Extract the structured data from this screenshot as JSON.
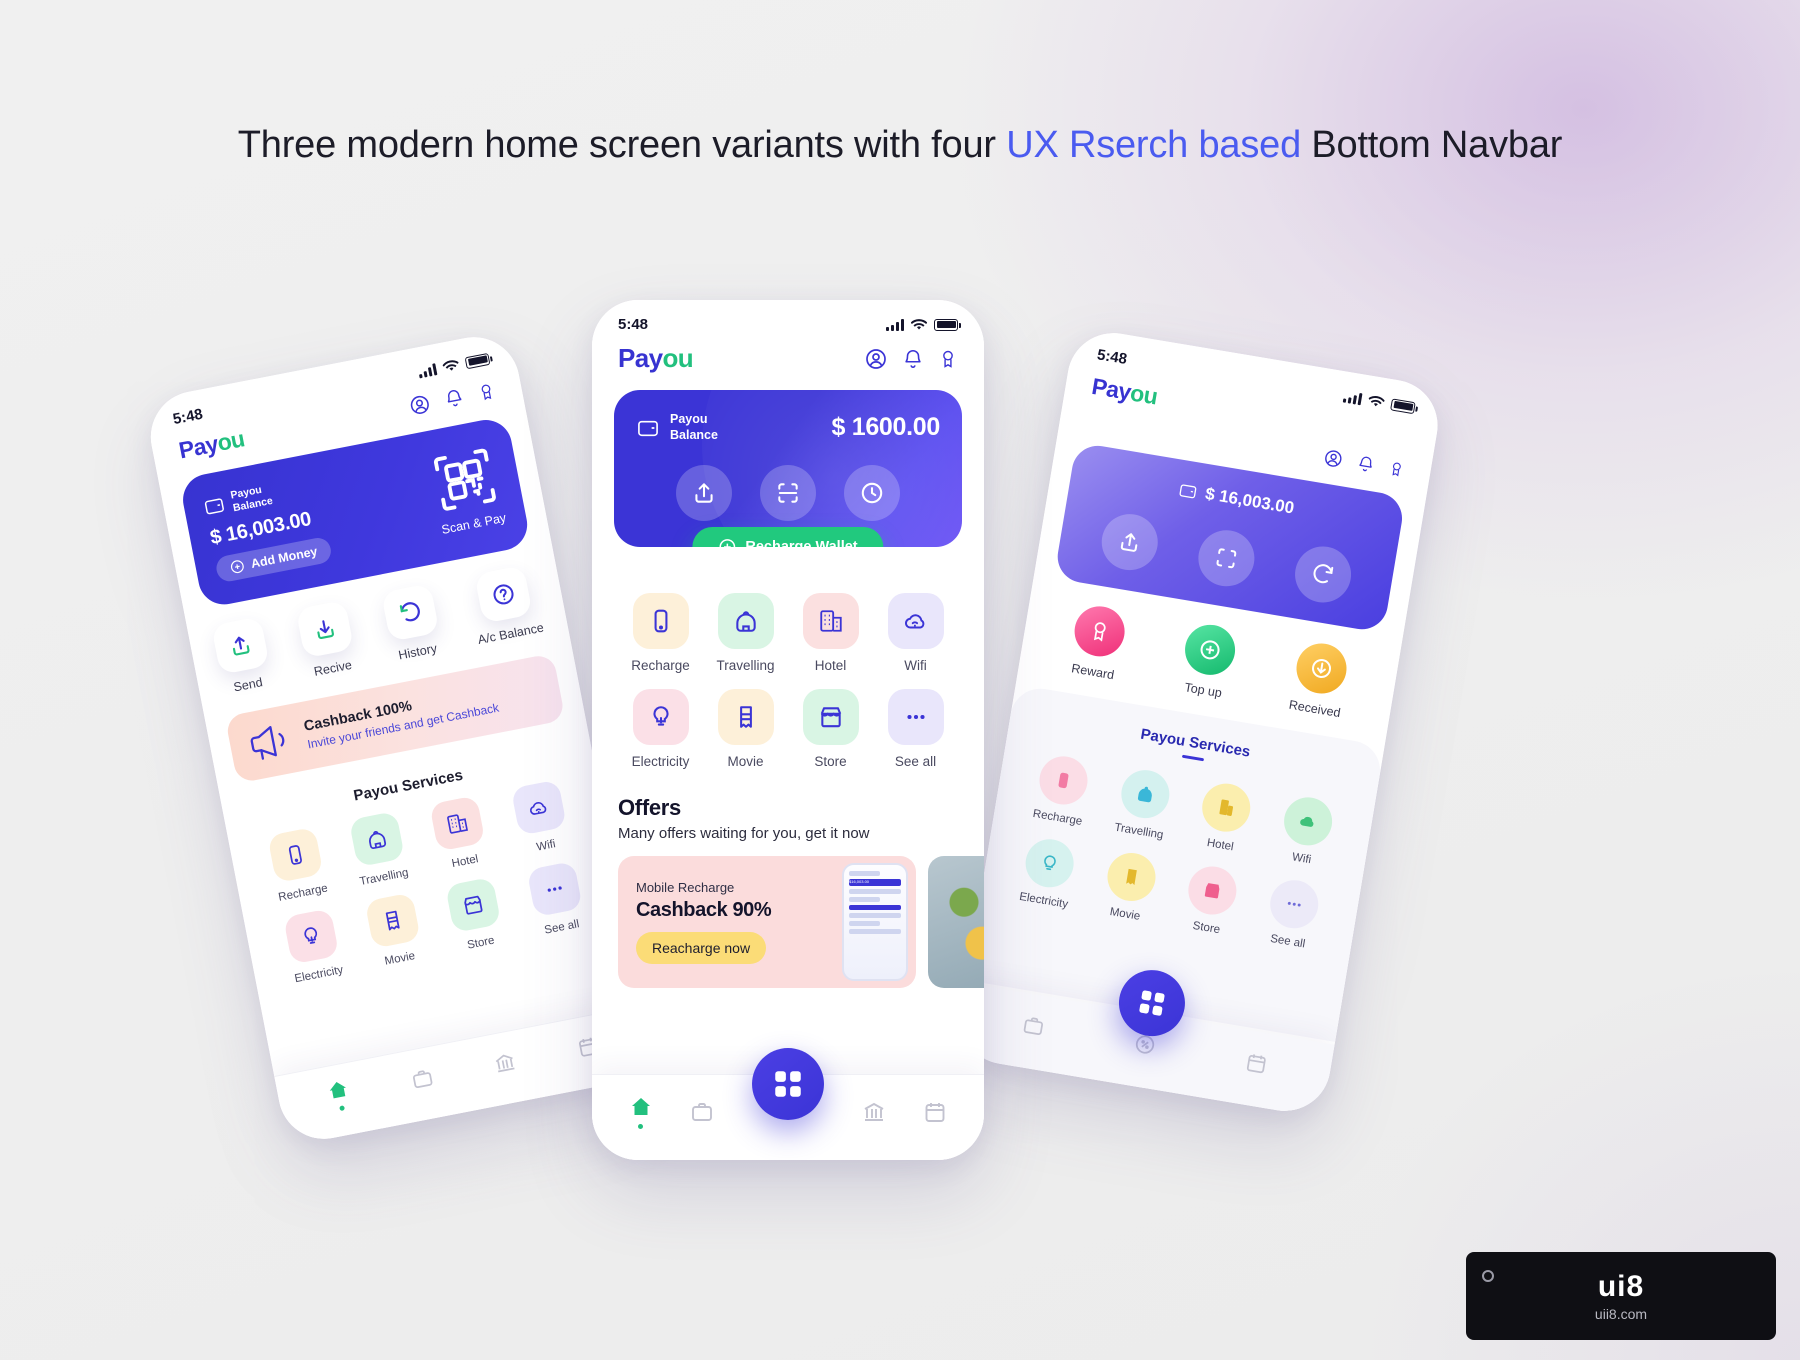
{
  "headline": {
    "part1": "Three modern home screen variants with four ",
    "accent": "UX Rserch based",
    "part2": " Bottom Navbar"
  },
  "brand": {
    "logo_part1": "Pay",
    "logo_part2": "ou",
    "accent_blue": "#3b34d6",
    "accent_green": "#22c07e"
  },
  "status": {
    "time": "5:48"
  },
  "header_icons": [
    "profile-icon",
    "bell-icon",
    "badge-icon"
  ],
  "center_phone": {
    "balance_card": {
      "wallet_label_line1": "Payou",
      "wallet_label_line2": "Balance",
      "amount": "$ 1600.00",
      "actions": [
        "send-icon",
        "scan-icon",
        "history-icon"
      ],
      "recharge_button": "Recharge Wallet"
    },
    "services": [
      {
        "label": "Recharge",
        "icon": "mobile-icon",
        "bg": "#fdf0d9"
      },
      {
        "label": "Travelling",
        "icon": "backpack-icon",
        "bg": "#d9f5e4"
      },
      {
        "label": "Hotel",
        "icon": "building-icon",
        "bg": "#fbe0e0"
      },
      {
        "label": "Wifi",
        "icon": "wifi-cloud-icon",
        "bg": "#e9e6fb"
      },
      {
        "label": "Electricity",
        "icon": "bulb-icon",
        "bg": "#fbe0e7"
      },
      {
        "label": "Movie",
        "icon": "ticket-icon",
        "bg": "#fdf0d9"
      },
      {
        "label": "Store",
        "icon": "store-icon",
        "bg": "#d9f5e4"
      },
      {
        "label": "See all",
        "icon": "more-dots-icon",
        "bg": "#e9e6fb"
      }
    ],
    "offers": {
      "title": "Offers",
      "subtitle": "Many offers waiting for you, get it now",
      "card": {
        "kicker": "Mobile Recharge",
        "title": "Cashback 90%",
        "button": "Reacharge now",
        "phone_amount": "$16,003.00"
      }
    },
    "navbar": [
      "home-icon",
      "briefcase-icon",
      "scan-fab-icon",
      "bank-icon",
      "calendar-icon"
    ]
  },
  "left_phone": {
    "balance_card": {
      "wallet_label_line1": "Payou",
      "wallet_label_line2": "Balance",
      "amount": "$ 16,003.00",
      "add_money": "Add Money",
      "scan_caption": "Scan & Pay"
    },
    "actions": [
      {
        "label": "Send",
        "icon": "send-icon"
      },
      {
        "label": "Recive",
        "icon": "receive-icon"
      },
      {
        "label": "History",
        "icon": "history-icon"
      },
      {
        "label": "A/c Balance",
        "icon": "question-icon"
      }
    ],
    "banner": {
      "title": "Cashback 100%",
      "subtitle": "Invite your friends and get Cashback",
      "icon": "megaphone-icon"
    },
    "services_title": "Payou Services",
    "services": [
      {
        "label": "Recharge",
        "icon": "mobile-icon",
        "bg": "#fdf0d9"
      },
      {
        "label": "Travelling",
        "icon": "backpack-icon",
        "bg": "#d9f5e4"
      },
      {
        "label": "Hotel",
        "icon": "building-icon",
        "bg": "#fbe0e0"
      },
      {
        "label": "Wifi",
        "icon": "wifi-cloud-icon",
        "bg": "#e9e6fb"
      },
      {
        "label": "Electricity",
        "icon": "bulb-icon",
        "bg": "#fbe0e7"
      },
      {
        "label": "Movie",
        "icon": "ticket-icon",
        "bg": "#fdf0d9"
      },
      {
        "label": "Store",
        "icon": "store-icon",
        "bg": "#d9f5e4"
      },
      {
        "label": "See all",
        "icon": "more-dots-icon",
        "bg": "#e9e6fb"
      }
    ],
    "navbar": [
      "home-icon",
      "briefcase-icon",
      "bank-icon",
      "calendar-icon"
    ]
  },
  "right_phone": {
    "balance_card": {
      "amount": "$ 16,003.00",
      "actions": [
        "send-icon",
        "scan-icon",
        "refresh-icon"
      ]
    },
    "quick": [
      {
        "label": "Reward",
        "icon": "badge-icon",
        "color": "#f0467f"
      },
      {
        "label": "Top up",
        "icon": "plus-icon",
        "color": "#23c07e"
      },
      {
        "label": "Received",
        "icon": "download-icon",
        "color": "#f5b53a"
      }
    ],
    "services_title": "Payou Services",
    "services": [
      {
        "label": "Recharge",
        "icon": "mobile-icon",
        "bg": "#fbdde6",
        "fg": "#f27ba4"
      },
      {
        "label": "Travelling",
        "icon": "backpack-icon",
        "bg": "#d4f1ef",
        "fg": "#3ab7d8"
      },
      {
        "label": "Hotel",
        "icon": "building-icon",
        "bg": "#fbeeae",
        "fg": "#eac33a"
      },
      {
        "label": "Wifi",
        "icon": "wifi-cloud-icon",
        "bg": "#cdf2d9",
        "fg": "#3fc27a"
      },
      {
        "label": "Electricity",
        "icon": "bulb-icon",
        "bg": "#d6f2ef",
        "fg": "#3ab7c8"
      },
      {
        "label": "Movie",
        "icon": "ticket-icon",
        "bg": "#fbeeae",
        "fg": "#eac33a"
      },
      {
        "label": "Store",
        "icon": "store-icon",
        "bg": "#fbdde6",
        "fg": "#ef5f8e"
      },
      {
        "label": "See all",
        "icon": "more-dots-icon",
        "bg": "#eceaf8",
        "fg": "#6f6bd8"
      }
    ],
    "navbar": [
      "briefcase-icon",
      "percent-icon",
      "calendar-icon",
      "scan-fab-icon"
    ]
  },
  "watermark": {
    "main": "ui8",
    "sub": "uii8.com"
  }
}
